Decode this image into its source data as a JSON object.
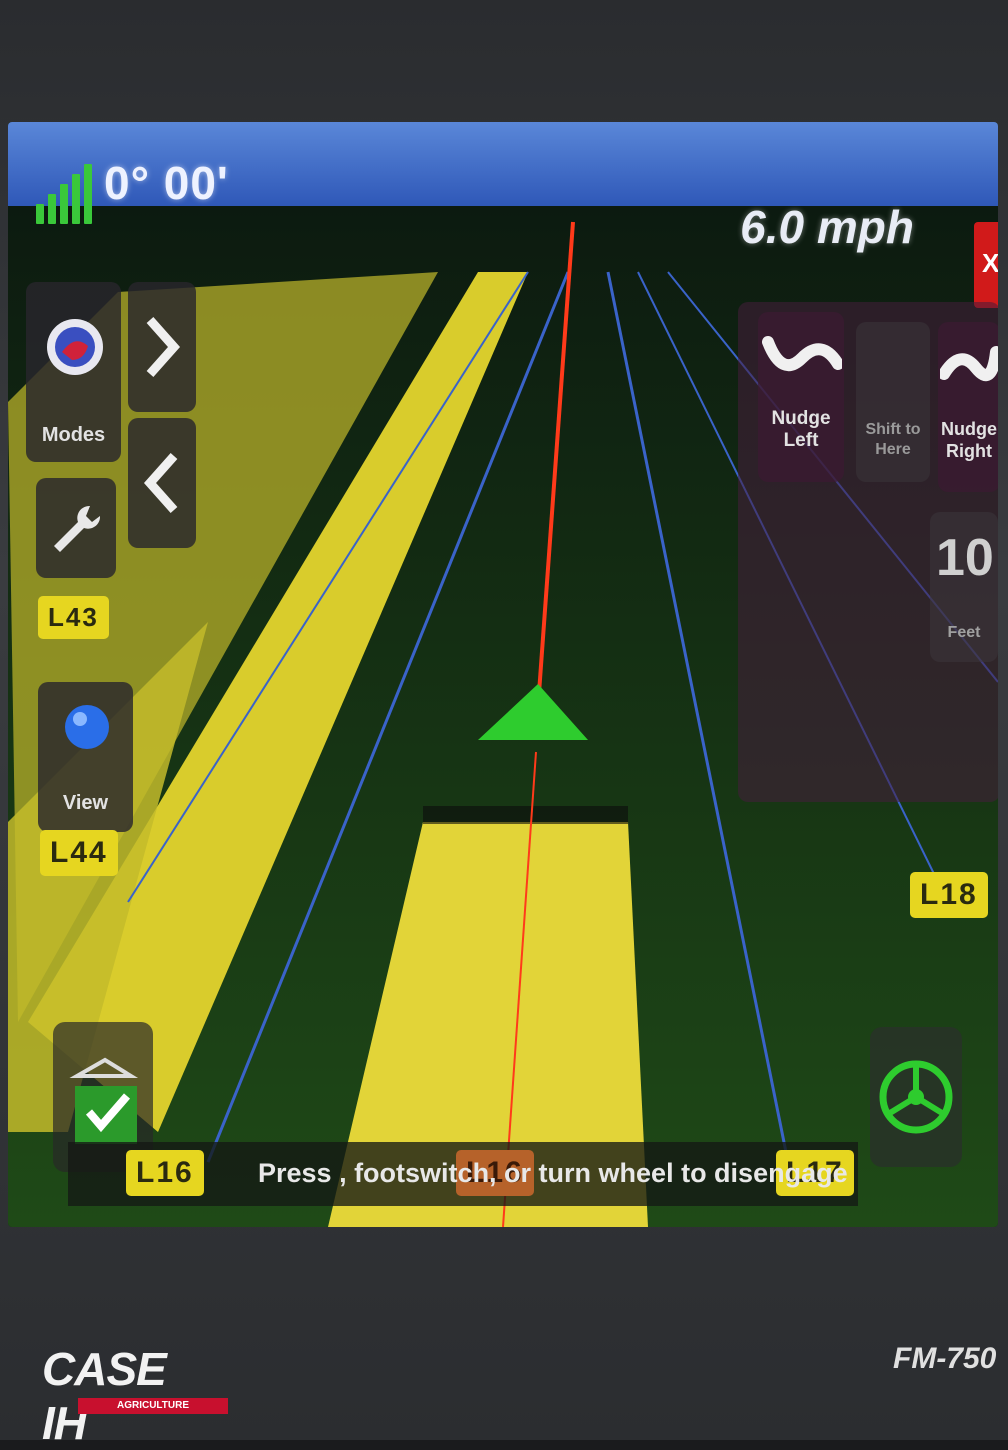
{
  "header": {
    "heading": "0° 00'",
    "speed": "6.0 mph"
  },
  "exit_tab": {
    "label": "X"
  },
  "left_menu": {
    "modes_label": "Modes",
    "view_label": "View",
    "swath_markers": [
      "L43",
      "L44"
    ]
  },
  "right_menu": {
    "nudge_left_label": "Nudge Left",
    "shift_label": "Shift to Here",
    "nudge_right_label": "Nudge Right",
    "offset_value": "10",
    "offset_label": "Feet"
  },
  "swath_markers": {
    "left_bottom": "L16",
    "center_bottom": "L16",
    "right_bottom": "L17",
    "right_mid": "L18"
  },
  "status": {
    "message": "Press , footswitch, or turn wheel to disengage"
  },
  "brand": {
    "name": "CASE IH",
    "sub": "AGRICULTURE",
    "model": "FM-750"
  },
  "colors": {
    "accent": "#2f58b8",
    "guideline": "#e63312",
    "swath": "#e6d620",
    "vehicle": "#2ecc2e"
  }
}
